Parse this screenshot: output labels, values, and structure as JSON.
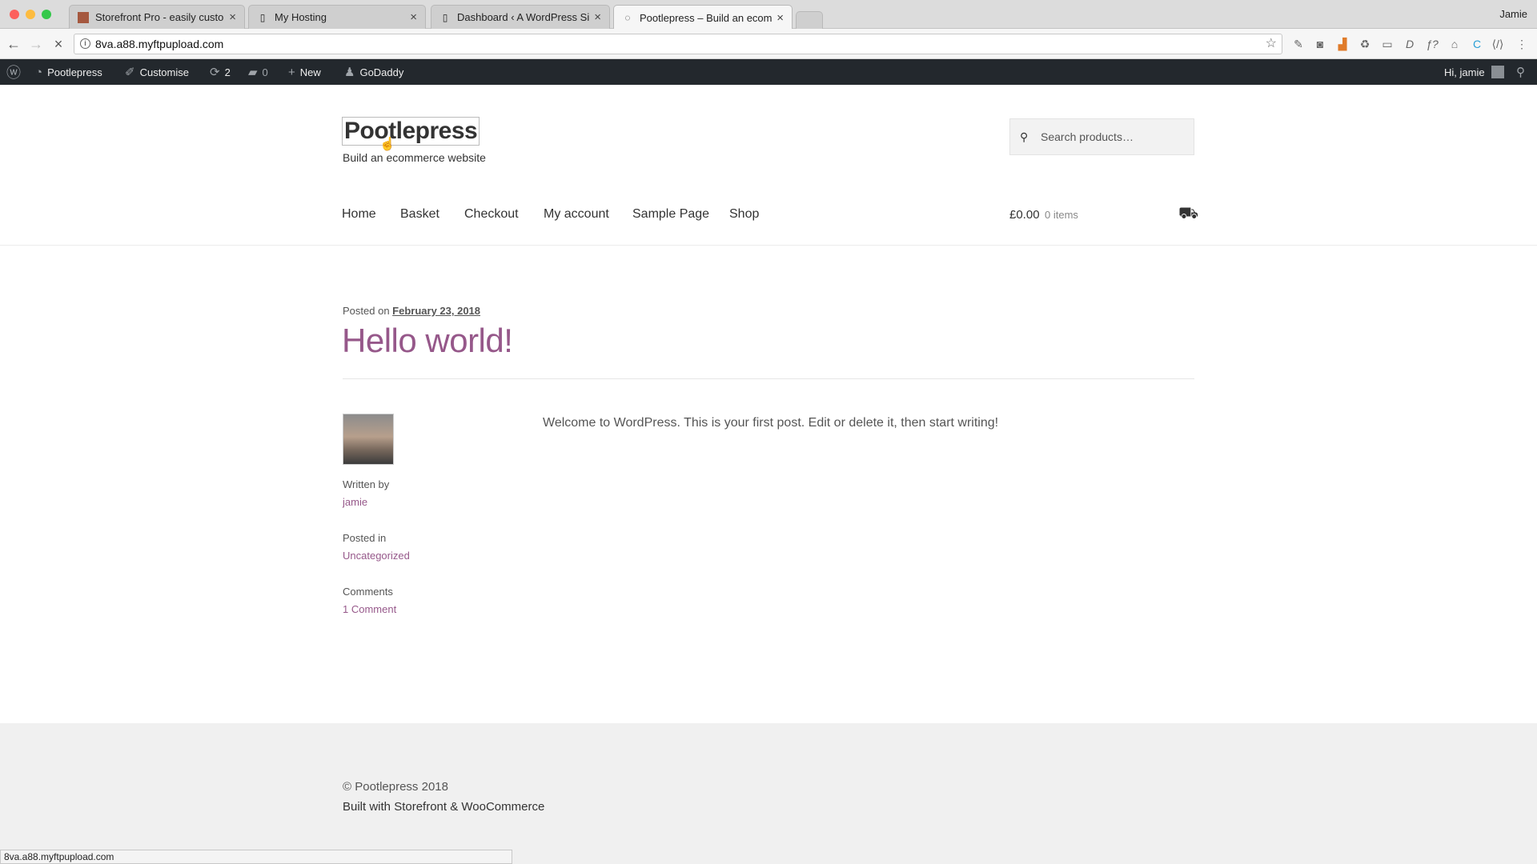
{
  "browser": {
    "profile": "Jamie",
    "tabs": [
      {
        "title": "Storefront Pro - easily customi",
        "active": false
      },
      {
        "title": "My Hosting",
        "active": false
      },
      {
        "title": "Dashboard ‹ A WordPress Site",
        "active": false
      },
      {
        "title": "Pootlepress – Build an ecomm",
        "active": true
      }
    ],
    "url": "8va.a88.myftpupload.com",
    "status_url": "8va.a88.myftpupload.com"
  },
  "adminbar": {
    "site": "Pootlepress",
    "customise": "Customise",
    "updates": "2",
    "comments": "0",
    "new": "New",
    "godaddy": "GoDaddy",
    "greeting": "Hi, jamie"
  },
  "header": {
    "site_title": "Pootlepress",
    "tagline": "Build an ecommerce website",
    "search_placeholder": "Search products…"
  },
  "nav": {
    "items": [
      "Home",
      "Basket",
      "Checkout",
      "My account",
      "Sample Page",
      "Shop"
    ]
  },
  "cart": {
    "total": "£0.00",
    "count": "0 items"
  },
  "post": {
    "posted_on_label": "Posted on",
    "date": "February 23, 2018",
    "title": "Hello world!",
    "body": "Welcome to WordPress. This is your first post. Edit or delete it, then start writing!",
    "written_by_label": "Written by",
    "author": "jamie",
    "posted_in_label": "Posted in",
    "category": "Uncategorized",
    "comments_label": "Comments",
    "comments_link": "1 Comment"
  },
  "footer": {
    "copyright": "© Pootlepress 2018",
    "built_with": "Built with Storefront & WooCommerce"
  },
  "colors": {
    "accent": "#96588a",
    "adminbar_bg": "#23282d",
    "footer_bg": "#f0f0f0"
  }
}
